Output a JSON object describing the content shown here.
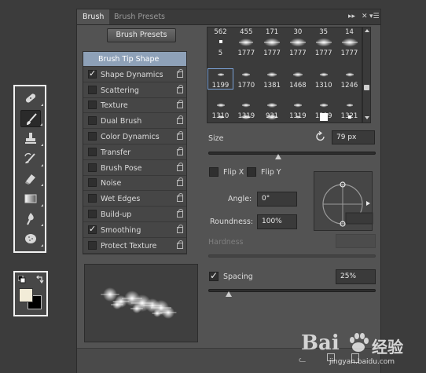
{
  "panel": {
    "tabs": [
      {
        "label": "Brush",
        "active": true
      },
      {
        "label": "Brush Presets",
        "active": false
      }
    ],
    "presets_button": "Brush Presets",
    "options": [
      {
        "label": "Brush Tip Shape",
        "checkbox": null,
        "selected": true
      },
      {
        "label": "Shape Dynamics",
        "checkbox": true
      },
      {
        "label": "Scattering",
        "checkbox": false
      },
      {
        "label": "Texture",
        "checkbox": false
      },
      {
        "label": "Dual Brush",
        "checkbox": false
      },
      {
        "label": "Color Dynamics",
        "checkbox": false
      },
      {
        "label": "Transfer",
        "checkbox": false
      },
      {
        "label": "Brush Pose",
        "checkbox": false
      },
      {
        "label": "Noise",
        "checkbox": false
      },
      {
        "label": "Wet Edges",
        "checkbox": false
      },
      {
        "label": "Build-up",
        "checkbox": false
      },
      {
        "label": "Smoothing",
        "checkbox": true
      },
      {
        "label": "Protect Texture",
        "checkbox": false
      }
    ],
    "brush_tips": {
      "top_partial": [
        "562",
        "455",
        "171",
        "30",
        "35",
        "14"
      ],
      "rows": [
        [
          "5",
          "1777",
          "1777",
          "1777",
          "1777",
          "1777"
        ],
        [
          "1199",
          "1770",
          "1381",
          "1468",
          "1310",
          "1246"
        ],
        [
          "1310",
          "1319",
          "931",
          "1319",
          "1319",
          "1321"
        ]
      ],
      "selected": "1199"
    },
    "size": {
      "label": "Size",
      "value": "79 px",
      "level": 0.42
    },
    "flip_x": {
      "label": "Flip X",
      "checked": false
    },
    "flip_y": {
      "label": "Flip Y",
      "checked": false
    },
    "angle": {
      "label": "Angle:",
      "value": "0°"
    },
    "roundness": {
      "label": "Roundness:",
      "value": "100%"
    },
    "hardness": {
      "label": "Hardness"
    },
    "spacing": {
      "label": "Spacing",
      "checked": true,
      "value": "25%",
      "level": 0.12
    }
  },
  "tools": [
    {
      "name": "healing-brush-tool",
      "active": false
    },
    {
      "name": "brush-tool",
      "active": true
    },
    {
      "name": "clone-stamp-tool",
      "active": false
    },
    {
      "name": "history-brush-tool",
      "active": false
    },
    {
      "name": "eraser-tool",
      "active": false
    },
    {
      "name": "gradient-tool",
      "active": false
    },
    {
      "name": "blur-tool",
      "active": false
    },
    {
      "name": "sponge-tool",
      "active": false
    }
  ],
  "colors": {
    "foreground": "#f2ecd8",
    "background": "#000000"
  },
  "watermark": {
    "brand": "Bai",
    "brand_suffix": "经验",
    "domain": "jingyan.baidu.com"
  }
}
